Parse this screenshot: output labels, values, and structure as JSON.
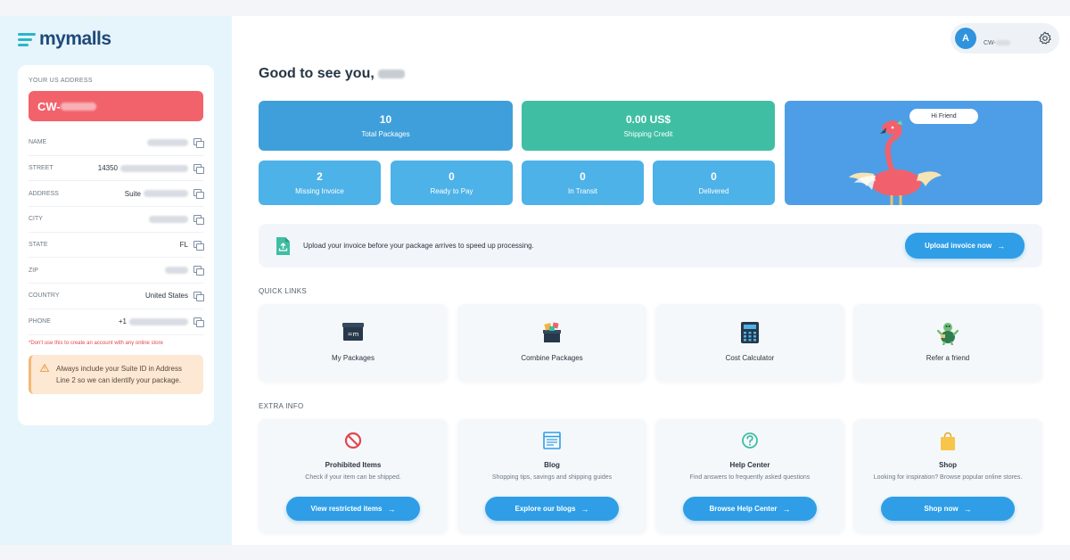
{
  "brand": {
    "name": "mymalls"
  },
  "address": {
    "title": "YOUR US ADDRESS",
    "suite_prefix": "CW-",
    "rows": [
      {
        "label": "NAME",
        "value": ""
      },
      {
        "label": "STREET",
        "value": "14350"
      },
      {
        "label": "ADDRESS",
        "value": "Suite"
      },
      {
        "label": "CITY",
        "value": ""
      },
      {
        "label": "STATE",
        "value": "FL"
      },
      {
        "label": "ZIP",
        "value": ""
      },
      {
        "label": "COUNTRY",
        "value": "United States"
      },
      {
        "label": "PHONE",
        "value": "+1"
      }
    ],
    "warning": "*Don't use this to create an account with any online store",
    "note": "Always include your Suite ID in Address Line 2 so we can identify your package."
  },
  "user": {
    "initial": "A",
    "id_prefix": "CW-"
  },
  "greeting": "Good to see you,",
  "stats": {
    "total": {
      "value": "10",
      "label": "Total Packages"
    },
    "credit": {
      "value": "0.00 US$",
      "label": "Shipping Credit"
    },
    "missing": {
      "value": "2",
      "label": "Missing Invoice"
    },
    "ready": {
      "value": "0",
      "label": "Ready to Pay"
    },
    "transit": {
      "value": "0",
      "label": "In Transit"
    },
    "delivered": {
      "value": "0",
      "label": "Delivered"
    }
  },
  "hero": {
    "bubble": "Hi Friend"
  },
  "upload": {
    "text": "Upload your invoice before your package arrives to speed up processing.",
    "button": "Upload invoice now"
  },
  "quick_links": {
    "label": "QUICK LINKS",
    "items": [
      "My Packages",
      "Combine Packages",
      "Cost Calculator",
      "Refer a friend"
    ]
  },
  "extra_info": {
    "label": "EXTRA INFO",
    "items": [
      {
        "title": "Prohibited Items",
        "desc": "Check if your item can be shipped.",
        "button": "View restricted items"
      },
      {
        "title": "Blog",
        "desc": "Shopping tips, savings and shipping guides",
        "button": "Explore our blogs"
      },
      {
        "title": "Help Center",
        "desc": "Find answers to frequently asked questions",
        "button": "Browse Help Center"
      },
      {
        "title": "Shop",
        "desc": "Looking for inspiration? Browse popular online stores.",
        "button": "Shop now"
      }
    ]
  },
  "colors": {
    "accent": "#2f9ee6",
    "suite_red": "#f2626b",
    "credit_green": "#3fbea3"
  }
}
